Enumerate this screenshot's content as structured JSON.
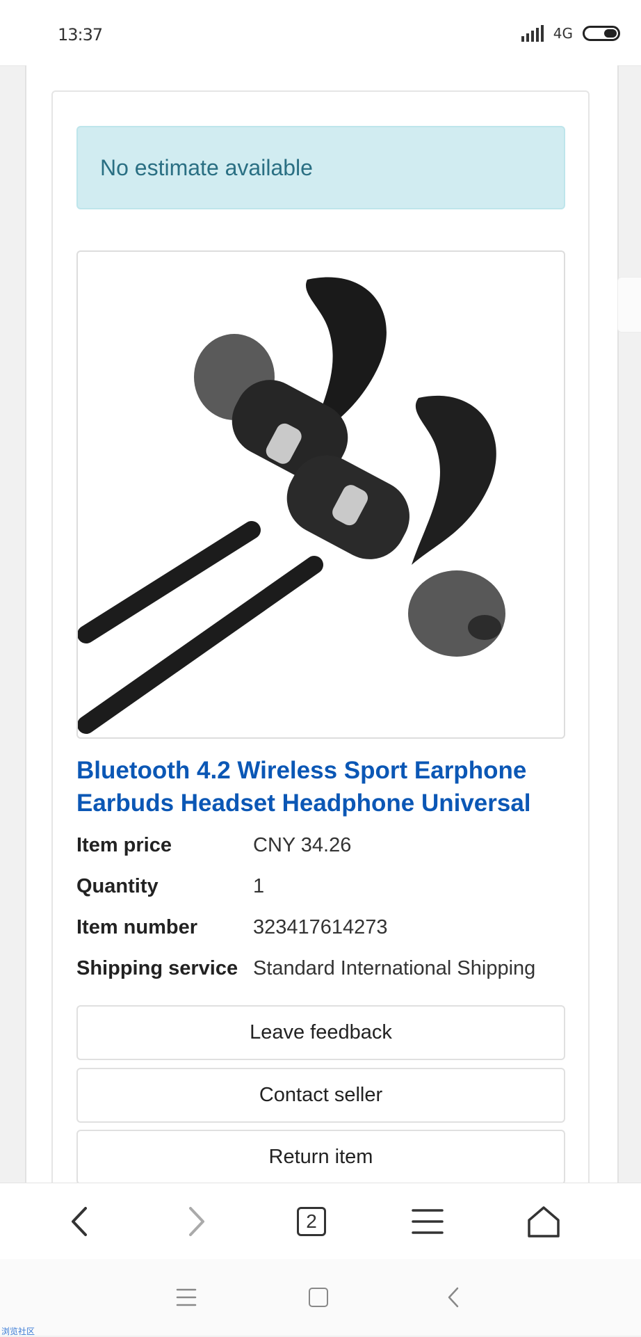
{
  "status_bar": {
    "time": "13:37",
    "network": "4G",
    "battery_icon": "battery-icon"
  },
  "order": {
    "estimate_notice": "No estimate available",
    "product_image_icon": "earphones-image",
    "title": "Bluetooth 4.2 Wireless Sport Earphone Earbuds Headset Headphone Universal",
    "details": [
      {
        "label": "Item price",
        "value": "CNY 34.26"
      },
      {
        "label": "Quantity",
        "value": "1"
      },
      {
        "label": "Item number",
        "value": "323417614273"
      },
      {
        "label": "Shipping service",
        "value": "Standard International Shipping"
      }
    ],
    "actions": {
      "leave_feedback": "Leave feedback",
      "contact_seller": "Contact seller",
      "return_item": "Return item"
    }
  },
  "browser_toolbar": {
    "tab_count": "2",
    "icons": [
      "back-icon",
      "forward-icon",
      "tabs-icon",
      "menu-icon",
      "home-icon"
    ]
  },
  "system_nav": {
    "icons": [
      "recents-icon",
      "home-square-icon",
      "back-chevron-icon"
    ]
  },
  "corner_label": "浏览社区",
  "colors": {
    "title_blue": "#0b57b5",
    "alert_bg": "#d1ecf1",
    "alert_text": "#2a6f83"
  }
}
